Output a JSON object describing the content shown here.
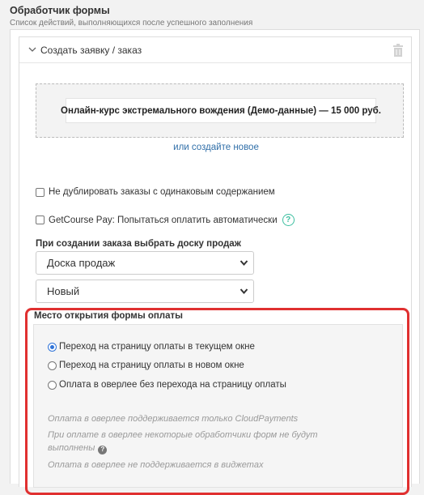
{
  "header": {
    "title": "Обработчик формы",
    "subtitle": "Список действий, выполняющихся после успешного заполнения"
  },
  "panel": {
    "title": "Создать заявку / заказ",
    "icons": {
      "collapse": "chevron-down-icon",
      "delete": "trash-icon"
    },
    "product": "Онлайн-курс экстремального вождения (Демо-данные) — 15 000 руб.",
    "create_link": "или создайте новое",
    "no_duplicate_label": "Не дублировать заказы с одинаковым содержанием",
    "no_duplicate_checked": false,
    "getcourse_pay_label": "GetCourse Pay: Попытаться оплатить автоматически",
    "getcourse_pay_checked": false,
    "help_glyph": "?",
    "board_label": "При создании заказа выбрать доску продаж",
    "board_select": "Доска продаж",
    "status_select": "Новый"
  },
  "payment": {
    "label": "Место открытия формы оплаты",
    "options": [
      {
        "label": "Переход на страницу оплаты в текущем окне",
        "checked": true
      },
      {
        "label": "Переход на страницу оплаты в новом окне",
        "checked": false
      },
      {
        "label": "Оплата в оверлее без перехода на страницу оплаты",
        "checked": false
      }
    ],
    "notes": [
      "Оплата в оверлее поддерживается только CloudPayments",
      "При оплате в оверлее некоторые обработчики форм не будут выполнены",
      "Оплата в оверлее не поддерживается в виджетах"
    ],
    "note_help_glyph": "?"
  },
  "colors": {
    "highlight": "#e03030",
    "link": "#2f6ea8",
    "radio_accent": "#2f73d8",
    "help_accent": "#3dbfa0"
  }
}
